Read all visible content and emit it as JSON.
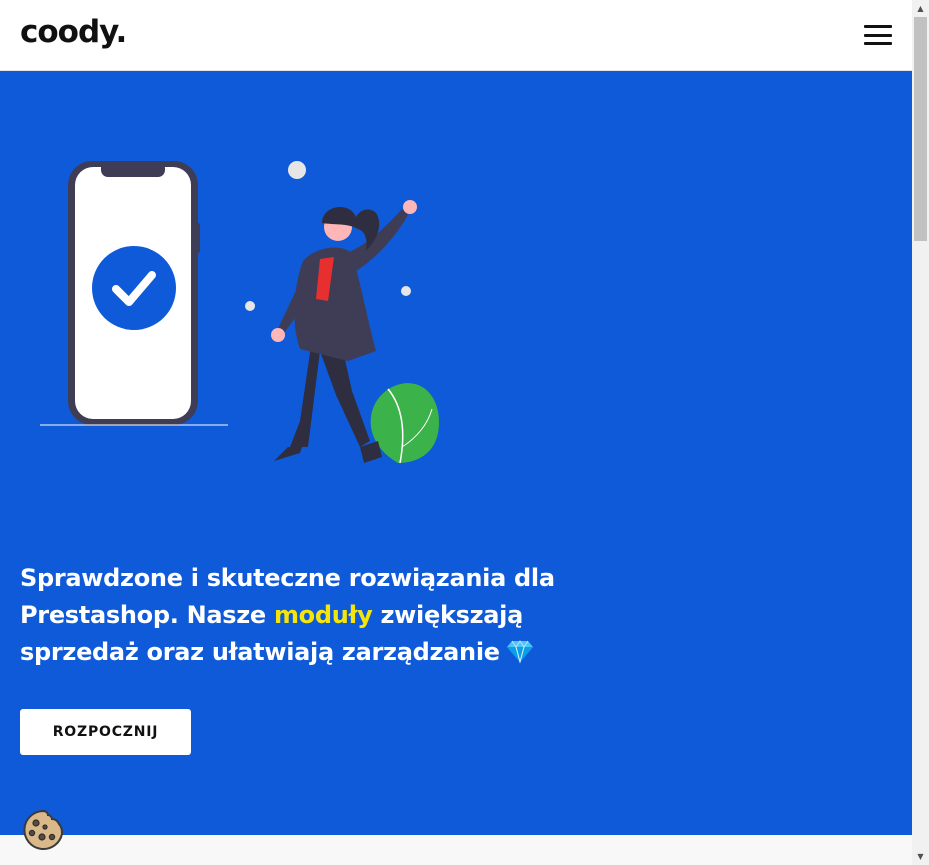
{
  "header": {
    "logo_text": "coody.",
    "menu_icon": "hamburger-menu-icon"
  },
  "hero": {
    "background_color": "#0f5ad8",
    "headline_part1": "Sprawdzone i skuteczne rozwiązania dla Prestashop. Nasze ",
    "headline_highlight": "moduły",
    "headline_part2": " zwiększają sprzedaż oraz ułatwiają zarządzanie",
    "highlight_color": "#f5e50b",
    "gem_icon": "gem-icon",
    "cta_label": "ROZPOCZNIJ",
    "illustration": "phone-checkmark-woman-illustration"
  },
  "cookie_widget": {
    "icon": "cookie-icon"
  },
  "scrollbar": {
    "up_icon": "scroll-up-arrow-icon",
    "down_icon": "scroll-down-arrow-icon"
  }
}
